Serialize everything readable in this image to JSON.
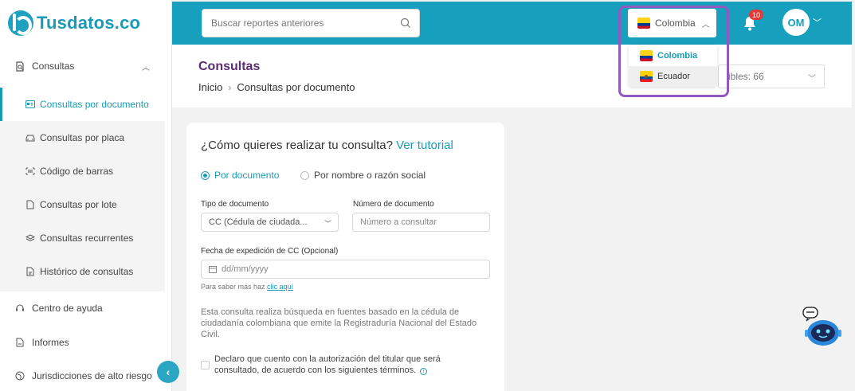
{
  "brand": {
    "name": "Tusdatos.co"
  },
  "sidebar": {
    "consultas_label": "Consultas",
    "items": [
      {
        "label": "Consultas por documento"
      },
      {
        "label": "Consultas por placa"
      },
      {
        "label": "Código de barras"
      },
      {
        "label": "Consultas por lote"
      },
      {
        "label": "Consultas recurrentes"
      },
      {
        "label": "Histórico de consultas"
      }
    ],
    "bottom": [
      {
        "label": "Centro de ayuda"
      },
      {
        "label": "Informes"
      },
      {
        "label": "Jurisdicciones de alto riesgo"
      }
    ]
  },
  "header": {
    "search_placeholder": "Buscar reportes anteriores",
    "country": "Colombia",
    "notifications": "10",
    "user_initials": "OM"
  },
  "dropdown": {
    "options": [
      "Colombia",
      "Ecuador"
    ]
  },
  "page": {
    "title": "Consultas",
    "breadcrumb_home": "Inicio",
    "breadcrumb_current": "Consultas por documento",
    "available_text": "ibles: 66"
  },
  "form": {
    "question": "¿Cómo quieres realizar tu consulta?",
    "tutorial_link": "Ver tutorial",
    "radio_document": "Por documento",
    "radio_name": "Por nombre o razón social",
    "doc_type_label": "Tipo de documento",
    "doc_type_value": "CC (Cédula de ciudada...",
    "doc_number_label": "Número de documento",
    "doc_number_placeholder": "Número a consultar",
    "date_label": "Fecha de expedición de CC (Opcional)",
    "date_placeholder": "dd/mm/yyyy",
    "hint_text": "Para saber más haz ",
    "hint_link": "clic aquí",
    "description": "Esta consulta realiza búsqueda en fuentes basado en la cédula de ciudadanía colombiana que emite la Registraduría Nacional del Estado Civil.",
    "consent_text": "Declaro que cuento con la autorización del titular que será consultado, de acuerdo con los siguientes términos."
  },
  "colors": {
    "primary": "#16a0bd",
    "title_purple": "#5b2d73",
    "highlight": "#9359c0"
  }
}
